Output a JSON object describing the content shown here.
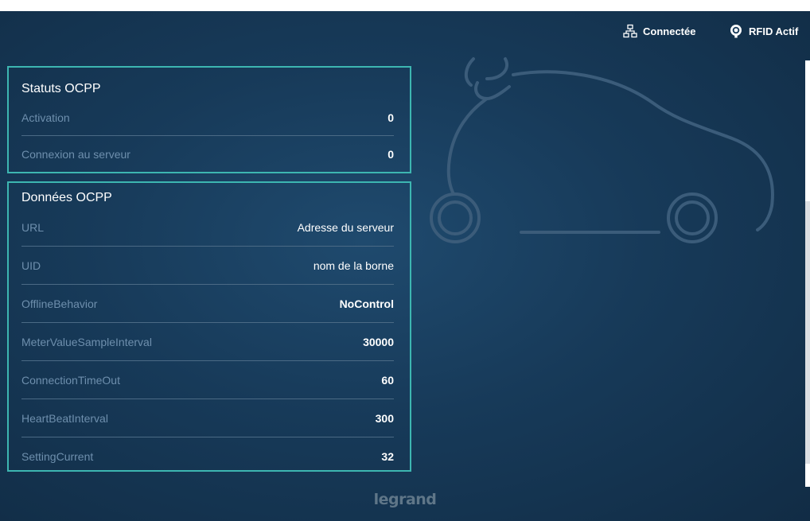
{
  "header": {
    "connection": {
      "label": "Connectée",
      "icon": "network-icon"
    },
    "rfid": {
      "label": "RFID Actif",
      "icon": "rfid-icon"
    }
  },
  "statuts": {
    "title": "Statuts OCPP",
    "rows": [
      {
        "label": "Activation",
        "value": "0"
      },
      {
        "label": "Connexion au serveur",
        "value": "0"
      }
    ]
  },
  "donnees": {
    "title": "Données OCPP",
    "rows": [
      {
        "label": "URL",
        "value": "Adresse du serveur"
      },
      {
        "label": "UID",
        "value": "nom de la borne"
      },
      {
        "label": "OfflineBehavior",
        "value": "NoControl"
      },
      {
        "label": "MeterValueSampleInterval",
        "value": "30000"
      },
      {
        "label": "ConnectionTimeOut",
        "value": "60"
      },
      {
        "label": "HeartBeatInterval",
        "value": "300"
      },
      {
        "label": "SettingCurrent",
        "value": "32"
      }
    ]
  },
  "footer": {
    "logo": "legrand"
  },
  "colors": {
    "accent_border": "#3db6b1",
    "background": "#173a59",
    "label_text": "#6e8fad"
  }
}
